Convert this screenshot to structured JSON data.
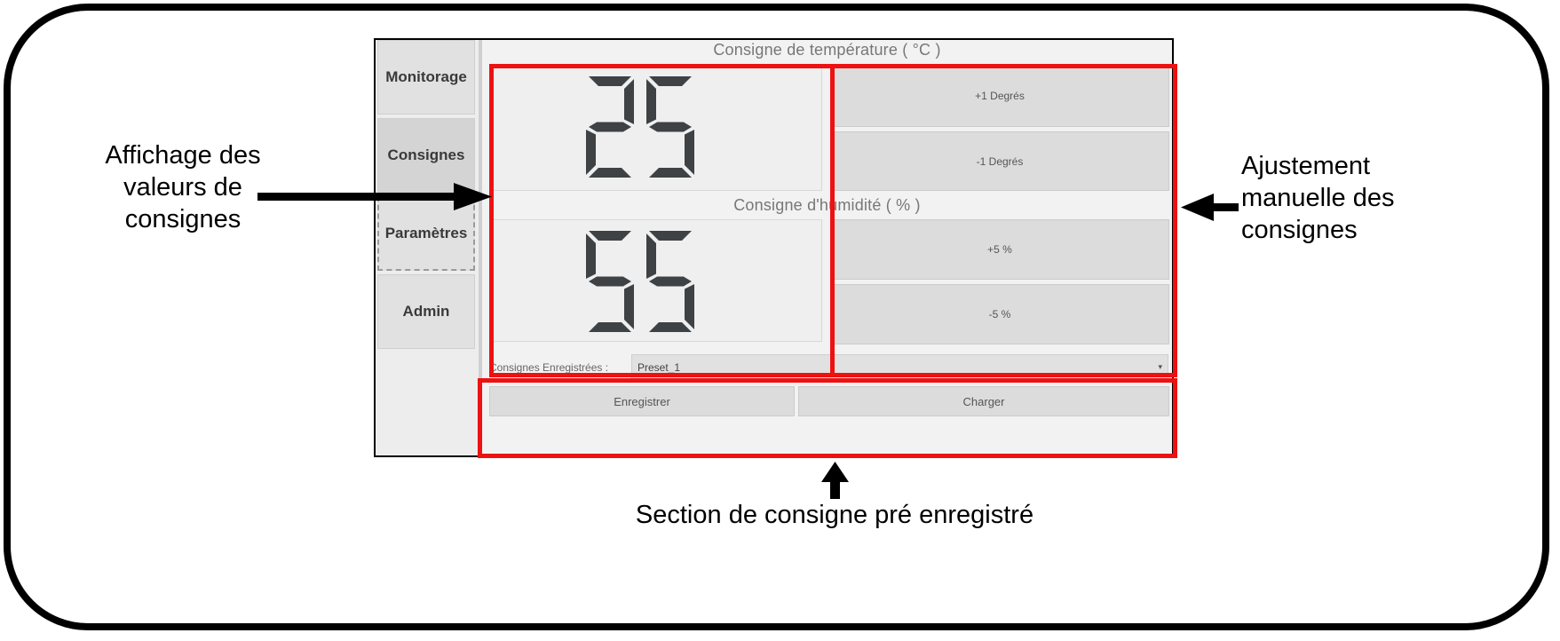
{
  "sidebar": {
    "items": [
      {
        "label": "Monitorage"
      },
      {
        "label": "Consignes"
      },
      {
        "label": "Paramètres"
      },
      {
        "label": "Admin"
      }
    ]
  },
  "temperature": {
    "title": "Consigne de température ( °C )",
    "value": "25",
    "plus_label": "+1 Degrés",
    "minus_label": "-1 Degrés"
  },
  "humidity": {
    "title": "Consigne d'humidité ( % )",
    "value": "55",
    "plus_label": "+5 %",
    "minus_label": "-5 %"
  },
  "presets": {
    "label": "Consignes Enregistrées :",
    "selected": "Preset_1",
    "save_label": "Enregistrer",
    "load_label": "Charger"
  },
  "annotations": {
    "left_line1": "Affichage des",
    "left_line2": "valeurs de",
    "left_line3": "consignes",
    "right_line1": "Ajustement",
    "right_line2": "manuelle des",
    "right_line3": "consignes",
    "bottom": "Section de consigne pré enregistré"
  },
  "colors": {
    "highlight": "#ee1111",
    "segment": "#3e4245"
  }
}
